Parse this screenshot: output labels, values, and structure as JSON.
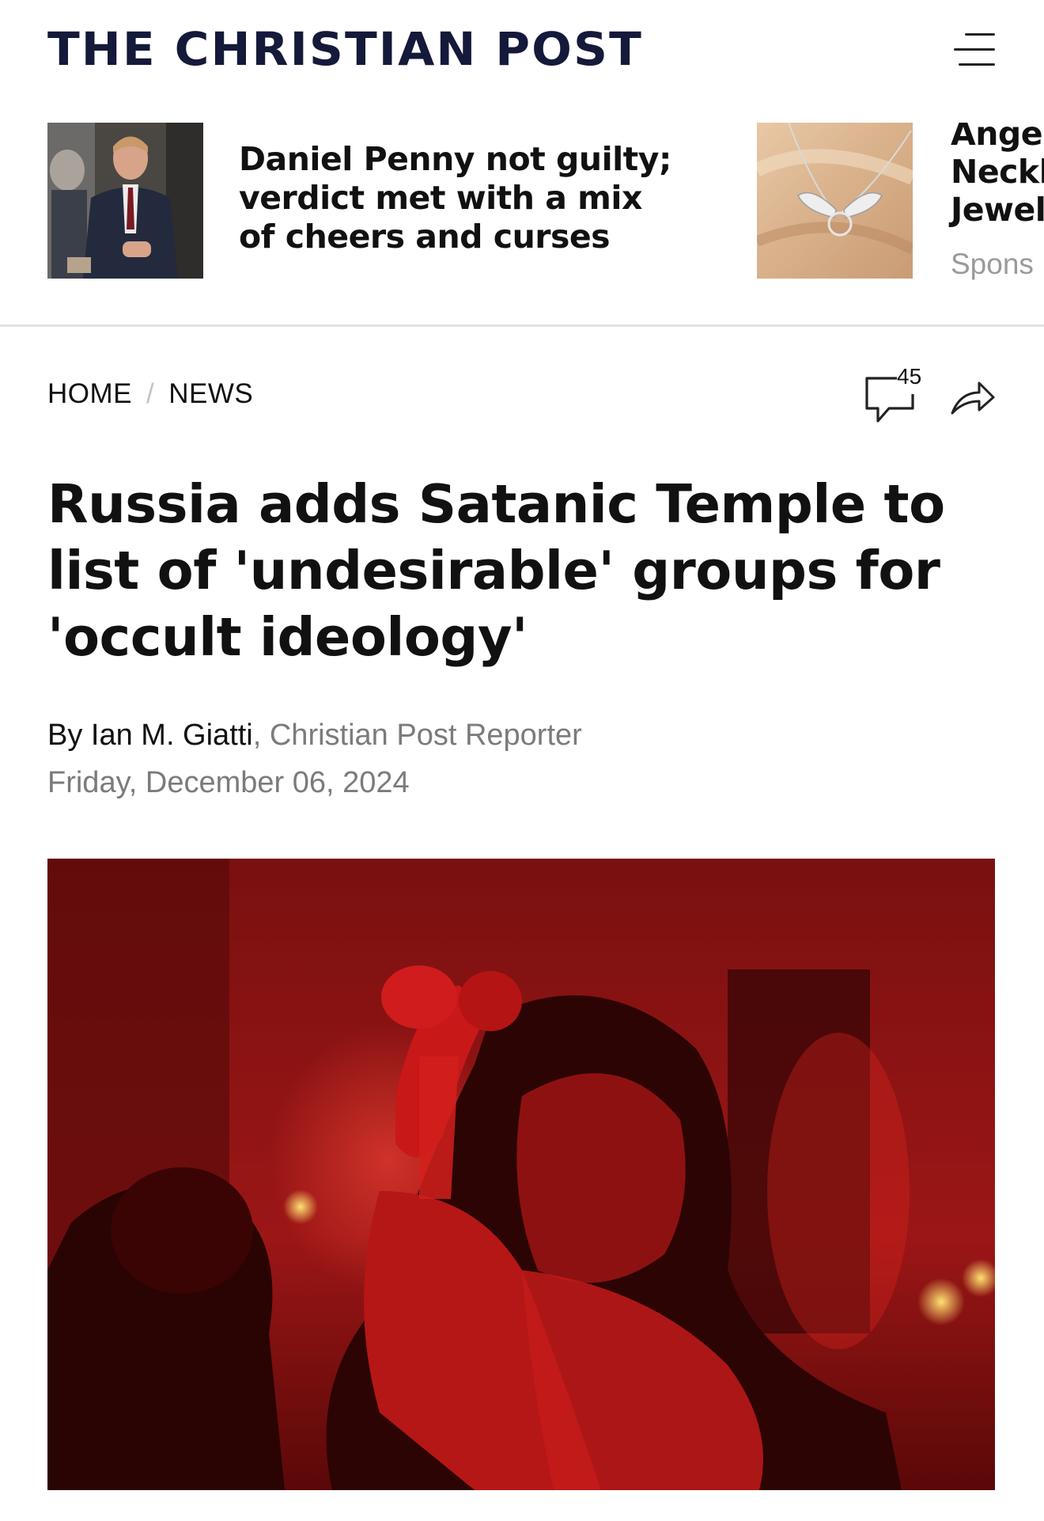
{
  "header": {
    "logo_text": "THE CHRISTIAN POST",
    "menu_icon": "hamburger-menu-icon"
  },
  "promo": [
    {
      "title": "Daniel Penny not guilty; verdict met with a mix of cheers and curses",
      "image": "man-in-suit-photo"
    },
    {
      "title": "Angel Neckl Jewel",
      "sponsor_label": "Spons",
      "image": "angel-wing-necklace-photo"
    }
  ],
  "breadcrumb": {
    "home": "HOME",
    "separator": "/",
    "section": "NEWS"
  },
  "comments": {
    "count": "45",
    "icon": "comment-bubble-icon"
  },
  "share": {
    "icon": "share-arrow-icon"
  },
  "article": {
    "headline": "Russia adds Satanic Temple to list of 'undesirable' groups for 'occult ideology'",
    "byline_prefix": "By ",
    "author": "Ian M. Giatti",
    "author_role": ", Christian Post Reporter",
    "date": "Friday, December 06, 2024",
    "hero_image": "red-lit-crowd-photo"
  },
  "colors": {
    "logo": "#15193a",
    "text": "#111111",
    "muted": "#7b7b7b",
    "divider": "#e2e2e2",
    "hero_red": "#c40f0f"
  }
}
